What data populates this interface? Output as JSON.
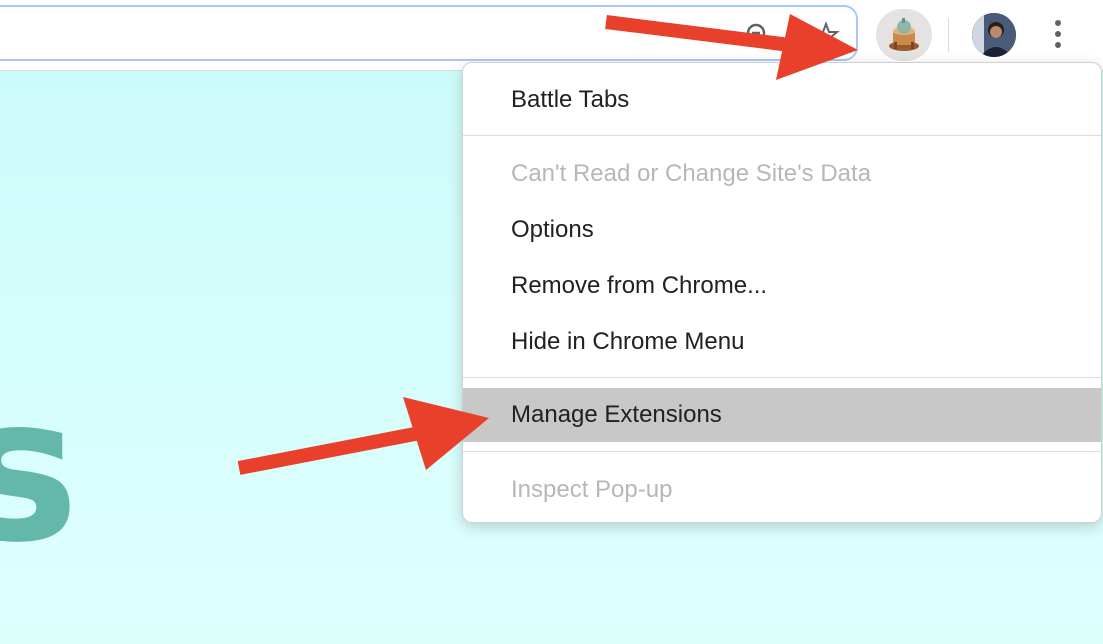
{
  "toolbar": {
    "omnibox_icons": [
      "zoom-icon",
      "star-icon"
    ],
    "extension_icon": "extension-icon",
    "profile_icon": "avatar",
    "menu_icon": "kebab-menu-icon"
  },
  "context_menu": {
    "items": [
      {
        "label": "Battle Tabs",
        "state": "enabled"
      },
      {
        "label": "Can't Read or Change Site's Data",
        "state": "disabled"
      },
      {
        "label": "Options",
        "state": "enabled"
      },
      {
        "label": "Remove from Chrome...",
        "state": "enabled"
      },
      {
        "label": "Hide in Chrome Menu",
        "state": "enabled"
      },
      {
        "label": "Manage Extensions",
        "state": "highlighted"
      },
      {
        "label": "Inspect Pop-up",
        "state": "disabled"
      }
    ]
  },
  "page_content": {
    "partial_letter": "s"
  },
  "colors": {
    "page_background": "#ccfcfa",
    "arrow": "#e8402a",
    "omnibox_border": "#a8c7fa",
    "highlight": "#c8c8c8",
    "disabled_text": "#b7b7b7",
    "letter": "#63b8a9"
  }
}
